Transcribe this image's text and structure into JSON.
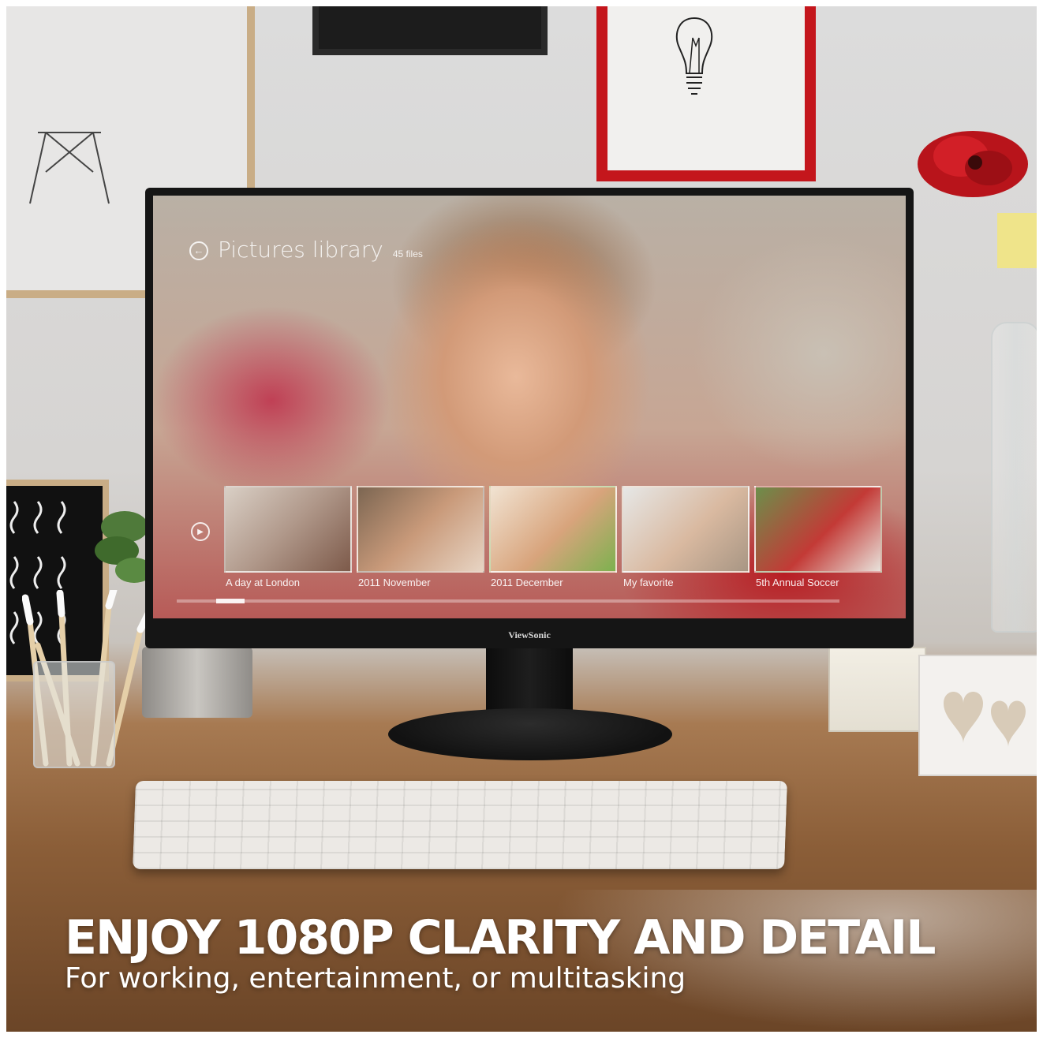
{
  "screen": {
    "title": "Pictures library",
    "file_count": "45 files",
    "albums": [
      {
        "caption": "A day at London"
      },
      {
        "caption": "2011 November"
      },
      {
        "caption": "2011 December"
      },
      {
        "caption": "My favorite"
      },
      {
        "caption": "5th Annual Soccer"
      }
    ]
  },
  "monitor": {
    "brand": "ViewSonic"
  },
  "overlay": {
    "headline": "ENJOY 1080P CLARITY AND DETAIL",
    "subline": "For working, entertainment, or multitasking"
  },
  "colors": {
    "frame_red": "#c4161c",
    "monitor_bezel": "#151515",
    "text": "#ffffff"
  }
}
